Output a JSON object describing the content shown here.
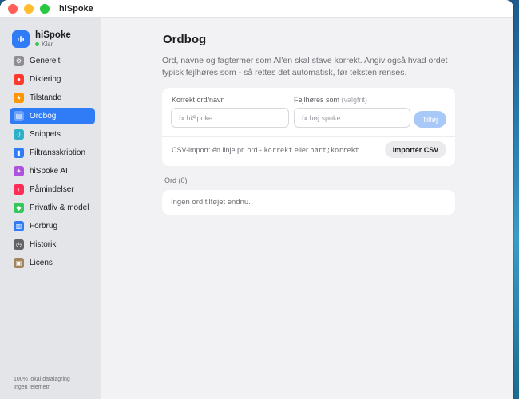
{
  "window": {
    "title": "hiSpoke"
  },
  "brand": {
    "name": "hiSpoke",
    "status": "Klar",
    "accent": "#2f7cf6",
    "status_color": "#34c759"
  },
  "sidebar": {
    "items": [
      {
        "label": "Generelt",
        "icon": "gear-icon",
        "color": "#8e8e93",
        "active": false
      },
      {
        "label": "Diktering",
        "icon": "microphone-icon",
        "color": "#ff3b30",
        "active": false
      },
      {
        "label": "Tilstande",
        "icon": "star-icon",
        "color": "#ff9500",
        "active": false
      },
      {
        "label": "Ordbog",
        "icon": "book-icon",
        "color": "#2f7cf6",
        "active": true
      },
      {
        "label": "Snippets",
        "icon": "braces-icon",
        "color": "#30b0c7",
        "active": false
      },
      {
        "label": "Filtransskription",
        "icon": "document-icon",
        "color": "#2f7cf6",
        "active": false
      },
      {
        "label": "hiSpoke AI",
        "icon": "sparkle-icon",
        "color": "#af52de",
        "active": false
      },
      {
        "label": "Påmindelser",
        "icon": "bell-icon",
        "color": "#ff2d55",
        "active": false
      },
      {
        "label": "Privatliv & model",
        "icon": "shield-icon",
        "color": "#34c759",
        "active": false
      },
      {
        "label": "Forbrug",
        "icon": "chart-icon",
        "color": "#2f7cf6",
        "active": false
      },
      {
        "label": "Historik",
        "icon": "clock-icon",
        "color": "#636366",
        "active": false
      },
      {
        "label": "Licens",
        "icon": "license-icon",
        "color": "#a2845e",
        "active": false
      }
    ],
    "footer_line1": "100% lokal datalagring",
    "footer_line2": "Ingen telemetri"
  },
  "main": {
    "title": "Ordbog",
    "description": "Ord, navne og fagtermer som AI'en skal stave korrekt. Angiv også hvad ordet typisk fejlhøres som - så rettes det automatisk, før teksten renses.",
    "form": {
      "correct_label": "Korrekt ord/navn",
      "correct_placeholder": "fx hiSpoke",
      "misheard_label": "Fejlhøres som",
      "misheard_optional": "(valgfrit)",
      "misheard_placeholder": "fx høj spoke",
      "add_button": "Tilføj"
    },
    "csv": {
      "text_prefix": "CSV-import: én linje pr. ord - ",
      "code1": "korrekt",
      "text_middle": " eller ",
      "code2": "hørt;korrekt",
      "import_button": "Importér CSV"
    },
    "words_label": "Ord (0)",
    "empty_text": "Ingen ord tilføjet endnu."
  }
}
